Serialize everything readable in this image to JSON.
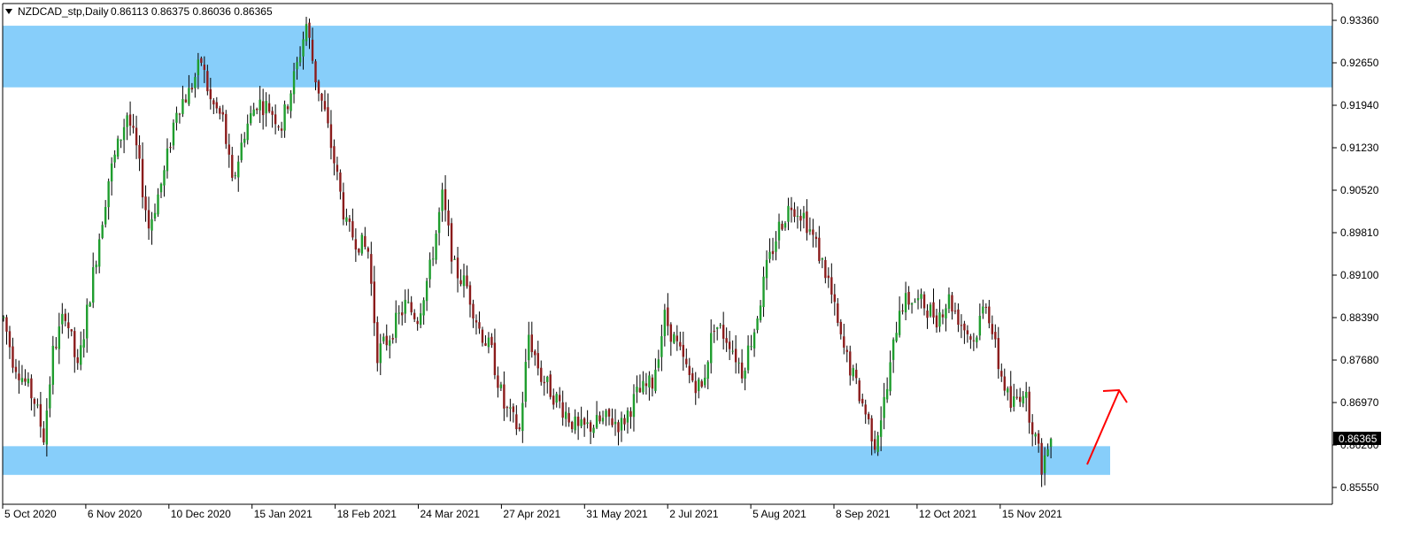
{
  "header": {
    "symbol": "NZDCAD_stp,Daily",
    "ohlc": "0.86113 0.86375 0.86036 0.86365"
  },
  "price_label": "0.86365",
  "colors": {
    "background": "#ffffff",
    "up_body": "#1f9d2e",
    "down_body": "#8b1c1c",
    "wick": "#000000",
    "zone": "#87cefa",
    "arrow": "#ff0000",
    "price_label_bg": "#000000",
    "price_label_text": "#ffffff"
  },
  "chart_data": {
    "type": "candlestick",
    "ylim": [
      0.8522,
      0.9362
    ],
    "y_ticks": [
      "0.93360",
      "0.92650",
      "0.91940",
      "0.91230",
      "0.90520",
      "0.89810",
      "0.89100",
      "0.88390",
      "0.87680",
      "0.86970",
      "0.86260",
      "0.85550"
    ],
    "x_ticks": [
      "5 Oct 2020",
      "6 Nov 2020",
      "10 Dec 2020",
      "15 Jan 2021",
      "18 Feb 2021",
      "24 Mar 2021",
      "27 Apr 2021",
      "31 May 2021",
      "2 Jul 2021",
      "5 Aug 2021",
      "8 Sep 2021",
      "12 Oct 2021",
      "15 Nov 2021"
    ],
    "zones": [
      {
        "from": 0.9224,
        "to": 0.9327,
        "extends": "full"
      },
      {
        "from": 0.8576,
        "to": 0.8624,
        "extends": "right-partial"
      }
    ],
    "last_close": 0.86365,
    "key_path": [
      [
        0,
        0.8838
      ],
      [
        3,
        0.877
      ],
      [
        10,
        0.87
      ],
      [
        13,
        0.864
      ],
      [
        16,
        0.878
      ],
      [
        20,
        0.885
      ],
      [
        24,
        0.875
      ],
      [
        28,
        0.888
      ],
      [
        34,
        0.907
      ],
      [
        40,
        0.918
      ],
      [
        43,
        0.912
      ],
      [
        47,
        0.899
      ],
      [
        52,
        0.908
      ],
      [
        56,
        0.919
      ],
      [
        60,
        0.9215
      ],
      [
        64,
        0.9268
      ],
      [
        67,
        0.92
      ],
      [
        71,
        0.917
      ],
      [
        74,
        0.906
      ],
      [
        78,
        0.915
      ],
      [
        82,
        0.92
      ],
      [
        86,
        0.919
      ],
      [
        90,
        0.916
      ],
      [
        95,
        0.926
      ],
      [
        98,
        0.933
      ],
      [
        101,
        0.924
      ],
      [
        104,
        0.918
      ],
      [
        107,
        0.91
      ],
      [
        111,
        0.899
      ],
      [
        114,
        0.897
      ],
      [
        118,
        0.895
      ],
      [
        121,
        0.878
      ],
      [
        124,
        0.88
      ],
      [
        130,
        0.886
      ],
      [
        134,
        0.884
      ],
      [
        138,
        0.892
      ],
      [
        142,
        0.904
      ],
      [
        146,
        0.892
      ],
      [
        150,
        0.889
      ],
      [
        154,
        0.882
      ],
      [
        158,
        0.878
      ],
      [
        162,
        0.869
      ],
      [
        167,
        0.865
      ],
      [
        170,
        0.881
      ],
      [
        174,
        0.874
      ],
      [
        178,
        0.871
      ],
      [
        182,
        0.868
      ],
      [
        186,
        0.865
      ],
      [
        191,
        0.866
      ],
      [
        196,
        0.867
      ],
      [
        200,
        0.866
      ],
      [
        205,
        0.871
      ],
      [
        210,
        0.873
      ],
      [
        214,
        0.884
      ],
      [
        218,
        0.879
      ],
      [
        222,
        0.874
      ],
      [
        226,
        0.872
      ],
      [
        230,
        0.883
      ],
      [
        235,
        0.88
      ],
      [
        239,
        0.875
      ],
      [
        243,
        0.882
      ],
      [
        247,
        0.892
      ],
      [
        251,
        0.899
      ],
      [
        255,
        0.903
      ],
      [
        259,
        0.901
      ],
      [
        263,
        0.896
      ],
      [
        267,
        0.89
      ],
      [
        271,
        0.88
      ],
      [
        275,
        0.874
      ],
      [
        279,
        0.868
      ],
      [
        282,
        0.863
      ],
      [
        286,
        0.872
      ],
      [
        290,
        0.886
      ],
      [
        294,
        0.887
      ],
      [
        298,
        0.886
      ],
      [
        302,
        0.884
      ],
      [
        306,
        0.887
      ],
      [
        310,
        0.883
      ],
      [
        314,
        0.88
      ],
      [
        318,
        0.887
      ],
      [
        322,
        0.876
      ],
      [
        326,
        0.869
      ],
      [
        330,
        0.872
      ],
      [
        333,
        0.866
      ],
      [
        336,
        0.859
      ],
      [
        339,
        0.8636
      ]
    ]
  }
}
